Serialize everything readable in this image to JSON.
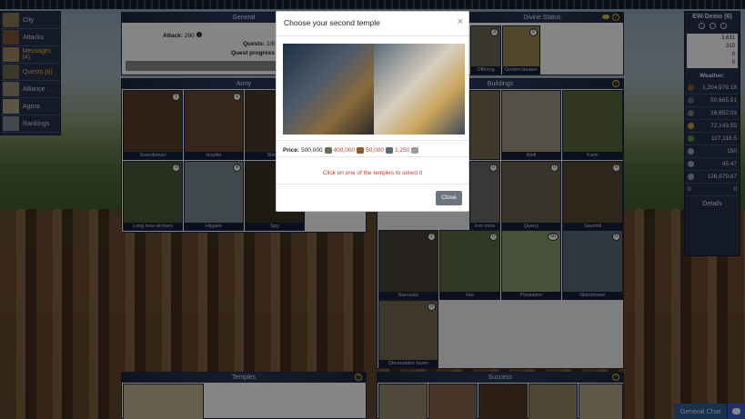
{
  "left_nav": {
    "items": [
      {
        "label": "City",
        "active": false
      },
      {
        "label": "Attacks",
        "active": false
      },
      {
        "label": "Messages (4)",
        "active": true
      },
      {
        "label": "Quests (6)",
        "active": true
      },
      {
        "label": "Alliance",
        "active": false
      },
      {
        "label": "Agora",
        "active": false
      },
      {
        "label": "Rankings",
        "active": false
      }
    ]
  },
  "general": {
    "title": "General",
    "attack_label": "Attack:",
    "attack_value": "290",
    "quests_label": "Quests:",
    "quests_value": "1/8",
    "quest_progress_label": "Quest progress"
  },
  "divine": {
    "title": "Divine Status",
    "items": [
      {
        "label": "Offering",
        "count": "3"
      },
      {
        "label": "Golden beaker",
        "count": "0"
      }
    ]
  },
  "army": {
    "title": "Army",
    "units": [
      {
        "label": "Swordsman",
        "count": "1"
      },
      {
        "label": "Hoplite",
        "count": "1"
      },
      {
        "label": "Slinger",
        "count": ""
      },
      {
        "label": "Long bow archers",
        "count": "0"
      },
      {
        "label": "Hippeis",
        "count": "4"
      },
      {
        "label": "Spy",
        "count": ""
      }
    ]
  },
  "buildings": {
    "title": "Buildings",
    "items": [
      {
        "label": "Barracks",
        "count": "1"
      },
      {
        "label": "Hut",
        "count": "0"
      },
      {
        "label": "Plantation",
        "count": "56"
      },
      {
        "label": "Watchtower",
        "count": "0"
      },
      {
        "label": "Observation tower",
        "count": "0"
      },
      {
        "label": "Well",
        "count": ""
      },
      {
        "label": "Farm",
        "count": ""
      },
      {
        "label": "Quarry",
        "count": "0"
      },
      {
        "label": "Sawmill",
        "count": "0"
      },
      {
        "label": "Grower's lodge",
        "count": ""
      },
      {
        "label": "Iron mine",
        "count": ""
      }
    ]
  },
  "temples": {
    "title": "Temples"
  },
  "success": {
    "title": "Success"
  },
  "right": {
    "title": "EW-Demo (6)",
    "stats": [
      "3,631",
      "310",
      "0",
      "0"
    ],
    "weather_label": "Weather:",
    "resources": [
      {
        "value": "1,204,979.18",
        "color": "#8b5a2b"
      },
      {
        "value": "50,665.51",
        "color": "#5b6b78"
      },
      {
        "value": "16,652.03",
        "color": "#7d7d7d"
      },
      {
        "value": "72,143.55",
        "color": "#c8a040"
      },
      {
        "value": "117,116.5",
        "color": "#6f8f3f"
      },
      {
        "value": "150",
        "color": "#9aa7b8"
      },
      {
        "value": "45.47",
        "color": "#9aa7b8"
      },
      {
        "value": "126,979.87",
        "color": "#9aa7b8"
      }
    ],
    "bottom": {
      "left": "0",
      "right": "0"
    },
    "details_label": "Details"
  },
  "modal": {
    "title": "Choose your second temple",
    "close_icon": "×",
    "price_label": "Price:",
    "price_gold": "500,000",
    "price_a": "400,000",
    "price_b": "50,000",
    "price_c": "1,250",
    "hint": "Click on one of the temples to select it",
    "close_button": "Close"
  },
  "chat": {
    "label": "General Chat"
  },
  "colors": {
    "navy": "#1b2740",
    "gold": "#e0b43a",
    "red": "#c0392b",
    "button": "#6c757d"
  }
}
